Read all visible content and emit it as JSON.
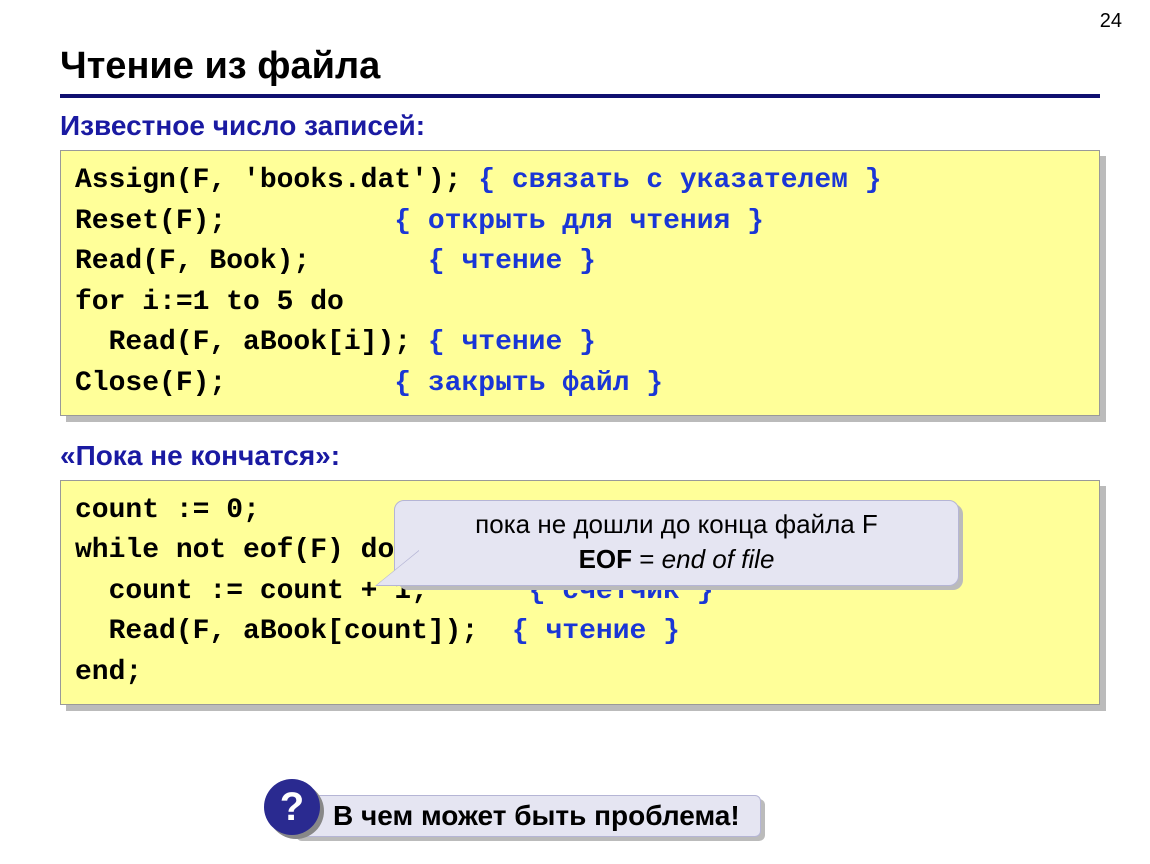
{
  "page_number": "24",
  "title": "Чтение из файла",
  "section1": {
    "heading": "Известное число записей:",
    "code": {
      "l1a": "Assign(F, 'books.dat'); ",
      "l1c": "{ связать с указателем }",
      "l2a": "Reset(F);          ",
      "l2c": "{ открыть для чтения }",
      "l3a": "Read(F, Book);       ",
      "l3c": "{ чтение }",
      "l4": "for i:=1 to 5 do",
      "l5a": "  Read(F, aBook[i]); ",
      "l5c": "{ чтение }",
      "l6a": "Close(F);          ",
      "l6c": "{ закрыть файл }"
    }
  },
  "section2": {
    "heading": "«Пока не кончатся»:",
    "code": {
      "l1": "count := 0;",
      "l2": "while not eof(F) do begin",
      "l3a": "  count := count + 1;      ",
      "l3c": "{ счетчик }",
      "l4a": "  Read(F, aBook[count]);  ",
      "l4c": "{ чтение }",
      "l5": "end;"
    }
  },
  "callout": {
    "line1": "пока не дошли до конца файла F",
    "eof_label": "EOF",
    "equals": " = ",
    "eof_meaning": "end of file"
  },
  "question": {
    "badge": "?",
    "text": "В чем может быть проблема!"
  }
}
